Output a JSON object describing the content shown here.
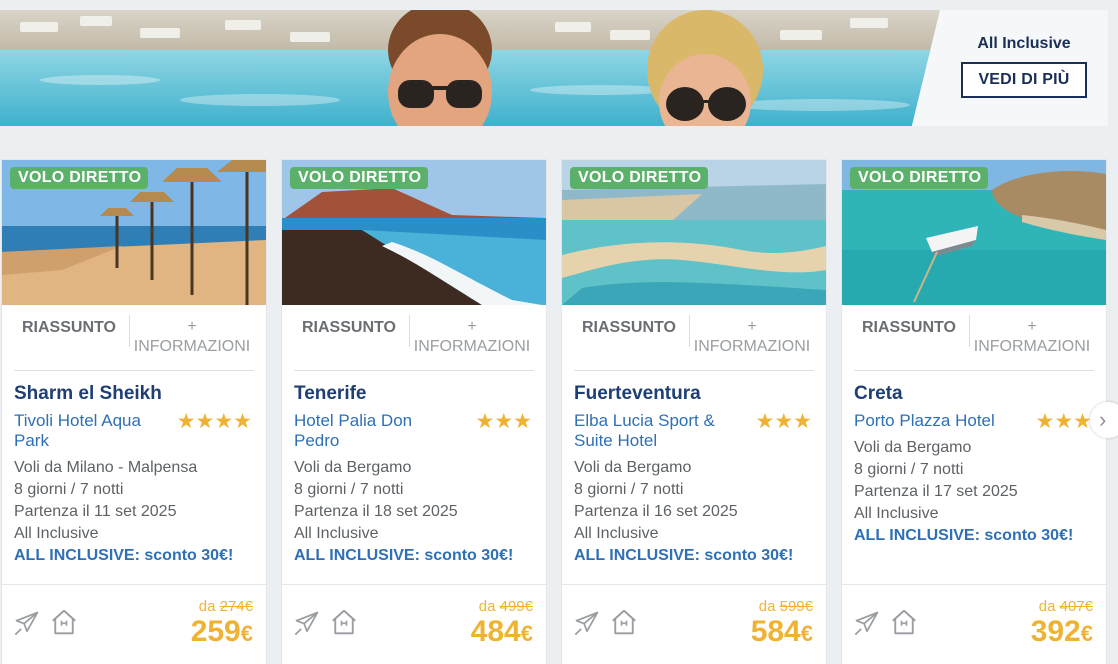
{
  "banner": {
    "title": "All Inclusive",
    "button_label": "VEDI DI PIÙ"
  },
  "cards": [
    {
      "badge": "VOLO DIRETTO",
      "tab_summary": "RIASSUNTO",
      "tab_info": "+ INFORMAZIONI",
      "destination": "Sharm el Sheikh",
      "hotel": "Tivoli Hotel Aqua Park",
      "stars": 4,
      "stars_text": "★★★★",
      "departure": "Voli da Milano - Malpensa",
      "duration": "8 giorni / 7 notti",
      "date": "Partenza il 11 set 2025",
      "board": "All Inclusive",
      "promo": "ALL INCLUSIVE: sconto 30€!",
      "price_from_label": "da",
      "old_price": "274€",
      "price": "259",
      "currency": "€"
    },
    {
      "badge": "VOLO DIRETTO",
      "tab_summary": "RIASSUNTO",
      "tab_info": "+ INFORMAZIONI",
      "destination": "Tenerife",
      "hotel": "Hotel Palia Don Pedro",
      "stars": 3,
      "stars_text": "★★★",
      "departure": "Voli da Bergamo",
      "duration": "8 giorni / 7 notti",
      "date": "Partenza il 18 set 2025",
      "board": "All Inclusive",
      "promo": "ALL INCLUSIVE: sconto 30€!",
      "price_from_label": "da",
      "old_price": "499€",
      "price": "484",
      "currency": "€"
    },
    {
      "badge": "VOLO DIRETTO",
      "tab_summary": "RIASSUNTO",
      "tab_info": "+ INFORMAZIONI",
      "destination": "Fuerteventura",
      "hotel": "Elba Lucia Sport & Suite Hotel",
      "stars": 3,
      "stars_text": "★★★",
      "departure": "Voli da Bergamo",
      "duration": "8 giorni / 7 notti",
      "date": "Partenza il 16 set 2025",
      "board": "All Inclusive",
      "promo": "ALL INCLUSIVE: sconto 30€!",
      "price_from_label": "da",
      "old_price": "599€",
      "price": "584",
      "currency": "€"
    },
    {
      "badge": "VOLO DIRETTO",
      "tab_summary": "RIASSUNTO",
      "tab_info": "+ INFORMAZIONI",
      "destination": "Creta",
      "hotel": "Porto Plazza Hotel",
      "stars": 3,
      "stars_text": "★★★",
      "departure": "Voli da Bergamo",
      "duration": "8 giorni / 7 notti",
      "date": "Partenza il 17 set 2025",
      "board": "All Inclusive",
      "promo": "ALL INCLUSIVE: sconto 30€!",
      "price_from_label": "da",
      "old_price": "407€",
      "price": "392",
      "currency": "€"
    }
  ],
  "carousel": {
    "next_icon": "chevron-right-icon",
    "next_glyph": "›"
  },
  "colors": {
    "brand_navy": "#1a2f56",
    "link_blue": "#2f6fb5",
    "badge_green": "#5bb16a",
    "price_orange": "#f0b233"
  }
}
